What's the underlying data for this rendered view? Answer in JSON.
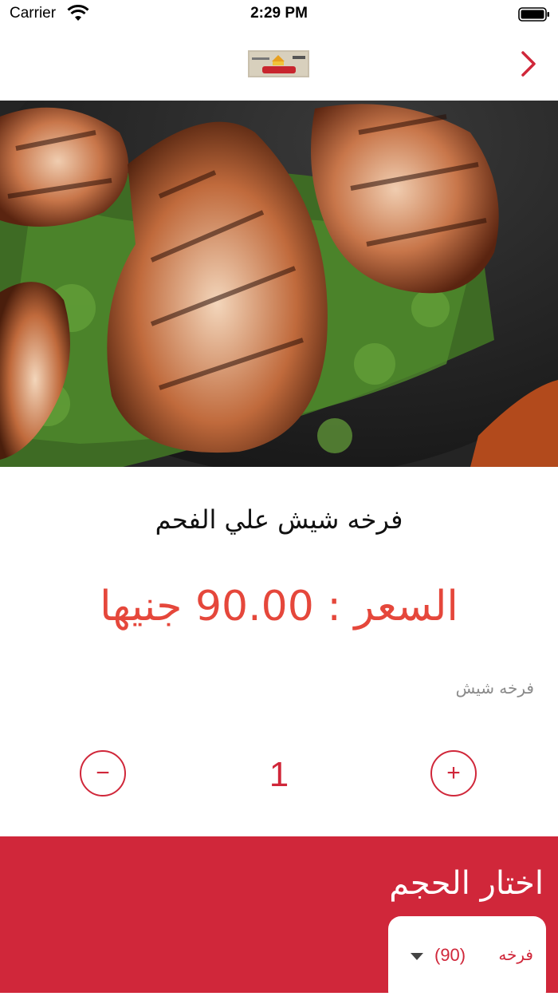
{
  "status_bar": {
    "carrier": "Carrier",
    "time": "2:29 PM"
  },
  "nav": {
    "logo_icon": "restaurant-logo-icon",
    "back_icon": "chevron-right-icon"
  },
  "product": {
    "title": "فرخه شيش علي الفحم",
    "price_text": "السعر :  90.00 جنيها",
    "description": "فرخه شيش"
  },
  "quantity": {
    "value": "1",
    "minus_label": "−",
    "plus_label": "+"
  },
  "size": {
    "heading": "اختار الحجم",
    "selected_name": "فرخه",
    "selected_price": "(90)"
  },
  "colors": {
    "accent": "#d0273a",
    "price": "#e5473b"
  }
}
